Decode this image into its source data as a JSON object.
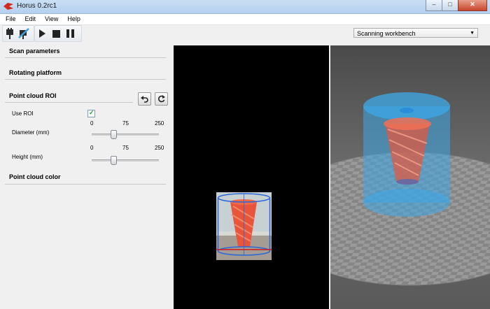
{
  "window": {
    "title": "Horus 0.2rc1"
  },
  "menu": [
    "File",
    "Edit",
    "View",
    "Help"
  ],
  "toolbar": {
    "buttons": [
      "connect-icon",
      "disconnect-icon",
      "play-icon",
      "stop-icon",
      "pause-icon"
    ],
    "workbench": {
      "selected": "Scanning workbench"
    }
  },
  "panel": {
    "scan_parameters": "Scan parameters",
    "rotating_platform": "Rotating platform",
    "roi": {
      "title": "Point cloud ROI",
      "use_roi_label": "Use ROI",
      "use_roi_checked": true,
      "diameter": {
        "label": "Diameter (mm)",
        "min": "0",
        "mid": "75",
        "max": "250",
        "value": 75
      },
      "height": {
        "label": "Height (mm)",
        "min": "0",
        "mid": "75",
        "max": "250",
        "value": 75
      }
    },
    "point_cloud_color": "Point cloud color"
  },
  "colors": {
    "object": "#e8553a",
    "roi": "#3da8e8",
    "camera_bg": "#000000",
    "scene_bg": "#5a5a5a"
  }
}
